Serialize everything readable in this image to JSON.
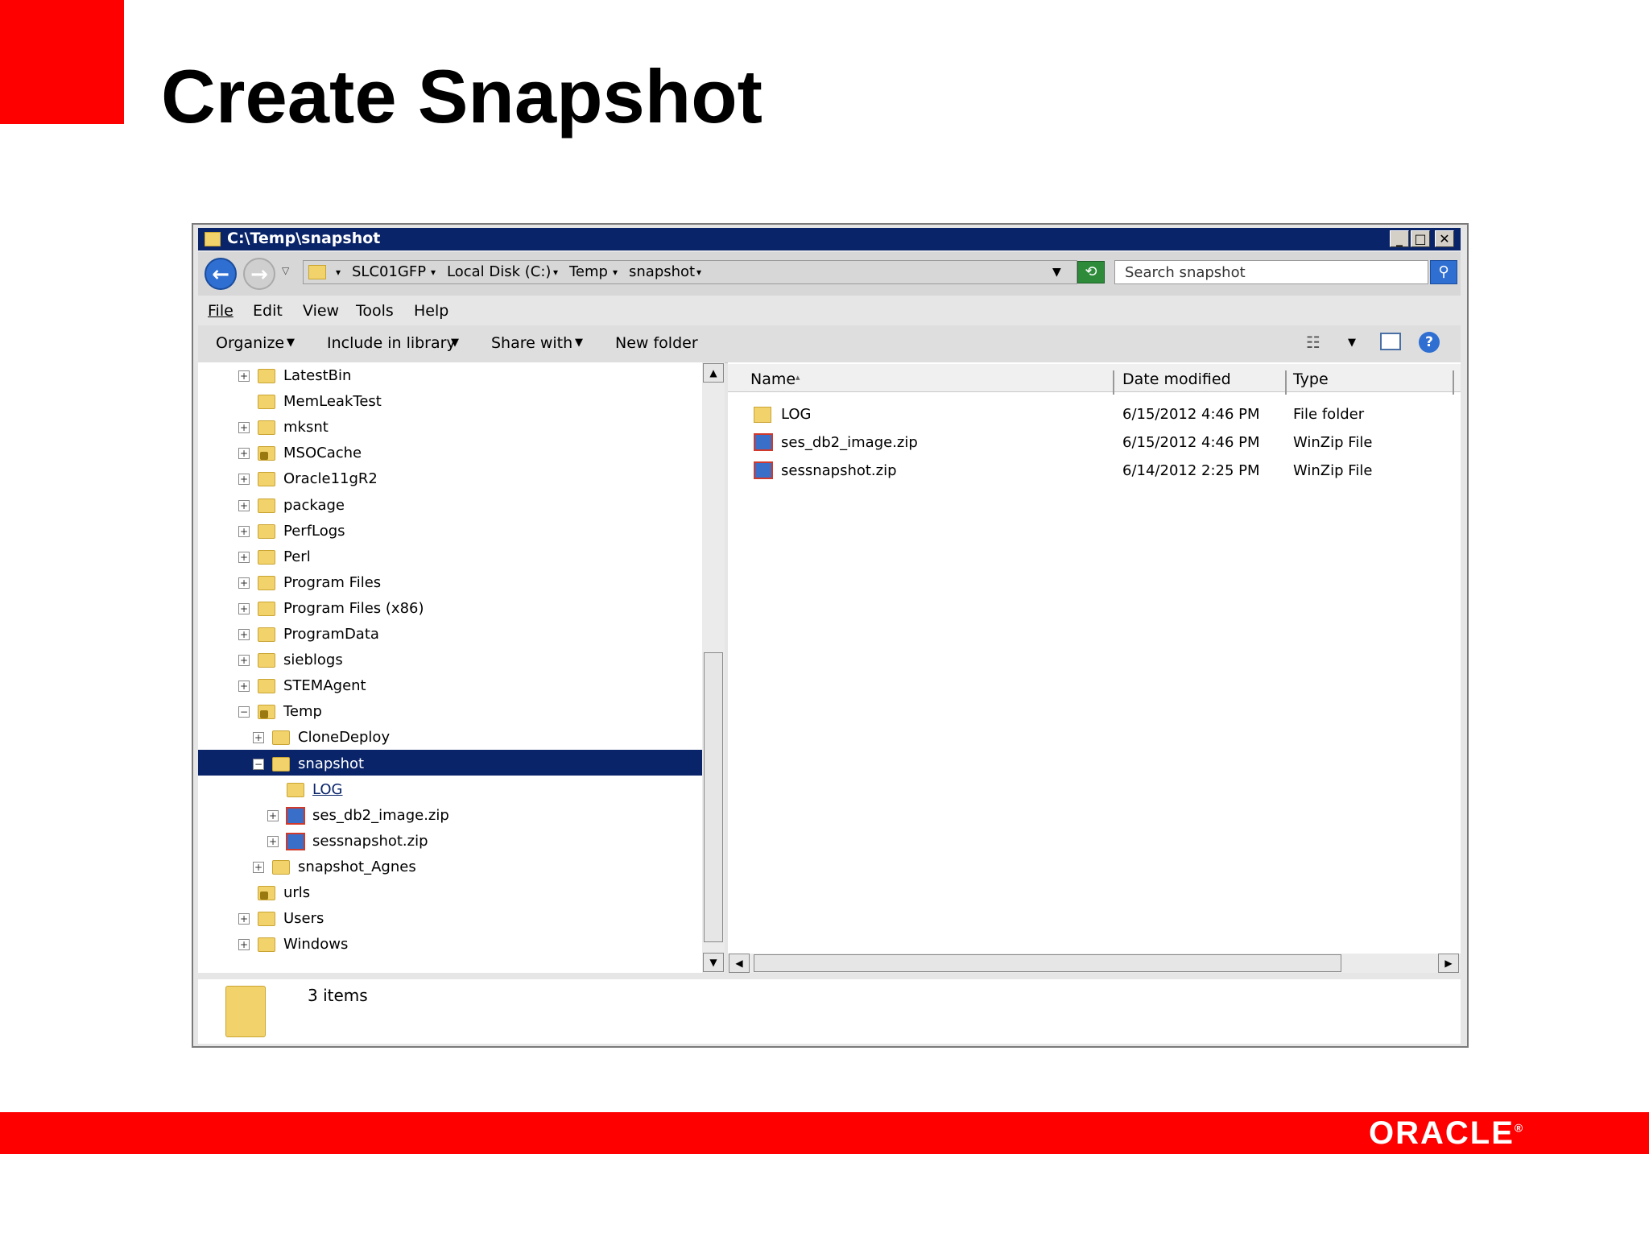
{
  "slide": {
    "title": "Create Snapshot",
    "logo_text": "ORACLE",
    "accent_color": "#ff0000"
  },
  "window": {
    "title": "C:\\Temp\\snapshot",
    "controls": {
      "minimize": "_",
      "maximize": "□",
      "close": "✕"
    }
  },
  "address": {
    "segments": [
      "SLC01GFP",
      "Local Disk (C:)",
      "Temp",
      "snapshot"
    ],
    "separator": "▾"
  },
  "search": {
    "placeholder": "Search snapshot"
  },
  "menu": [
    "File",
    "Edit",
    "View",
    "Tools",
    "Help"
  ],
  "commands": {
    "organize": "Organize",
    "include_in_library": "Include in library",
    "share_with": "Share with",
    "new_folder": "New folder"
  },
  "tree": [
    {
      "label": "LatestBin",
      "expand": "+"
    },
    {
      "label": "MemLeakTest",
      "expand": ""
    },
    {
      "label": "mksnt",
      "expand": "+"
    },
    {
      "label": "MSOCache",
      "expand": "+"
    },
    {
      "label": "Oracle11gR2",
      "expand": "+"
    },
    {
      "label": "package",
      "expand": "+"
    },
    {
      "label": "PerfLogs",
      "expand": "+"
    },
    {
      "label": "Perl",
      "expand": "+"
    },
    {
      "label": "Program Files",
      "expand": "+"
    },
    {
      "label": "Program Files (x86)",
      "expand": "+"
    },
    {
      "label": "ProgramData",
      "expand": "+"
    },
    {
      "label": "sieblogs",
      "expand": "+"
    },
    {
      "label": "STEMAgent",
      "expand": "+"
    },
    {
      "label": "Temp",
      "expand": "−"
    },
    {
      "label": "CloneDeploy",
      "expand": "+"
    },
    {
      "label": "snapshot",
      "expand": "−"
    },
    {
      "label": "LOG",
      "expand": ""
    },
    {
      "label": "ses_db2_image.zip",
      "expand": "+"
    },
    {
      "label": "sessnapshot.zip",
      "expand": "+"
    },
    {
      "label": "snapshot_Agnes",
      "expand": "+"
    },
    {
      "label": "urls",
      "expand": ""
    },
    {
      "label": "Users",
      "expand": "+"
    },
    {
      "label": "Windows",
      "expand": "+"
    }
  ],
  "columns": {
    "name": "Name",
    "date_modified": "Date modified",
    "type": "Type",
    "sort_indicator": "▴"
  },
  "files": [
    {
      "name": "LOG",
      "date": "6/15/2012 4:46 PM",
      "type": "File folder"
    },
    {
      "name": "ses_db2_image.zip",
      "date": "6/15/2012 4:46 PM",
      "type": "WinZip File"
    },
    {
      "name": "sessnapshot.zip",
      "date": "6/14/2012 2:25 PM",
      "type": "WinZip File"
    }
  ],
  "status": {
    "item_count": "3 items"
  },
  "scroll": {
    "up": "▲",
    "down": "▼",
    "left": "◀",
    "right": "▶"
  }
}
